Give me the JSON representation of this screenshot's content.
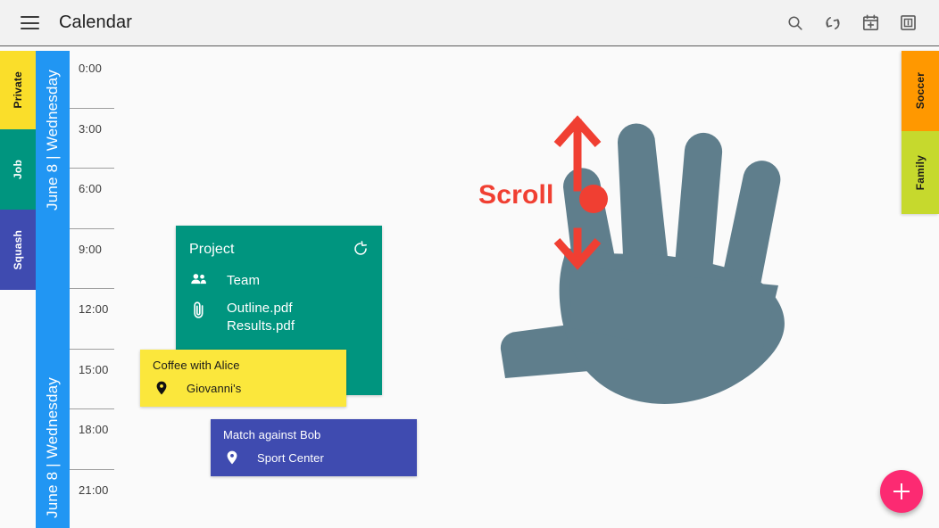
{
  "appbar": {
    "menu_icon": "hamburger-menu-icon",
    "title": "Calendar",
    "actions": [
      {
        "name": "search-icon",
        "label": "Search"
      },
      {
        "name": "sync-icon",
        "label": "Sync"
      },
      {
        "name": "calendar-add-icon",
        "label": "Add calendar"
      },
      {
        "name": "calendar-day-icon",
        "label": "Day view"
      }
    ]
  },
  "left_tabs": [
    {
      "label": "Private",
      "color": "#fade2a",
      "text_color": "#1a1a1a",
      "height": 88
    },
    {
      "label": "Job",
      "color": "#00957f",
      "text_color": "#ffffff",
      "height": 90
    },
    {
      "label": "Squash",
      "color": "#3f4bb0",
      "text_color": "#ffffff",
      "height": 90
    }
  ],
  "right_tabs": [
    {
      "label": "Soccer",
      "color": "#ff9800",
      "text_color": "#1a1a1a",
      "height": 90
    },
    {
      "label": "Family",
      "color": "#c6d92d",
      "text_color": "#1a1a1a",
      "height": 93
    }
  ],
  "day_column": {
    "color": "#2196f3",
    "label_top": "June 8 | Wednesday",
    "label_bottom": "June 8 | Wednesday"
  },
  "time_axis": {
    "hours": [
      "0:00",
      "3:00",
      "6:00",
      "9:00",
      "12:00",
      "15:00",
      "18:00",
      "21:00"
    ]
  },
  "events": [
    {
      "id": "project",
      "title": "Project",
      "color": "#00957f",
      "recurrence_icon": "recurrence-icon",
      "attendees_icon": "people-icon",
      "attendees": "Team",
      "attachment_icon": "paperclip-icon",
      "attachments": "Outline.pdf\nResults.pdf"
    },
    {
      "id": "coffee",
      "title": "Coffee with Alice",
      "color": "#fbe73c",
      "location_icon": "location-pin-icon",
      "location": "Giovanni's"
    },
    {
      "id": "match",
      "title": "Match against Bob",
      "color": "#3f4bb0",
      "location_icon": "location-pin-icon",
      "location": "Sport Center"
    }
  ],
  "gesture": {
    "label": "Scroll",
    "label_color": "#f03f32",
    "hand_color": "#5f7e8c",
    "arrow_color": "#f03f32",
    "touch_point_color": "#f03f32",
    "up_arrow": "arrow-up-icon",
    "down_arrow": "arrow-down-icon"
  },
  "fab": {
    "label": "+",
    "name": "add-event-fab",
    "color": "#fc2a72"
  }
}
